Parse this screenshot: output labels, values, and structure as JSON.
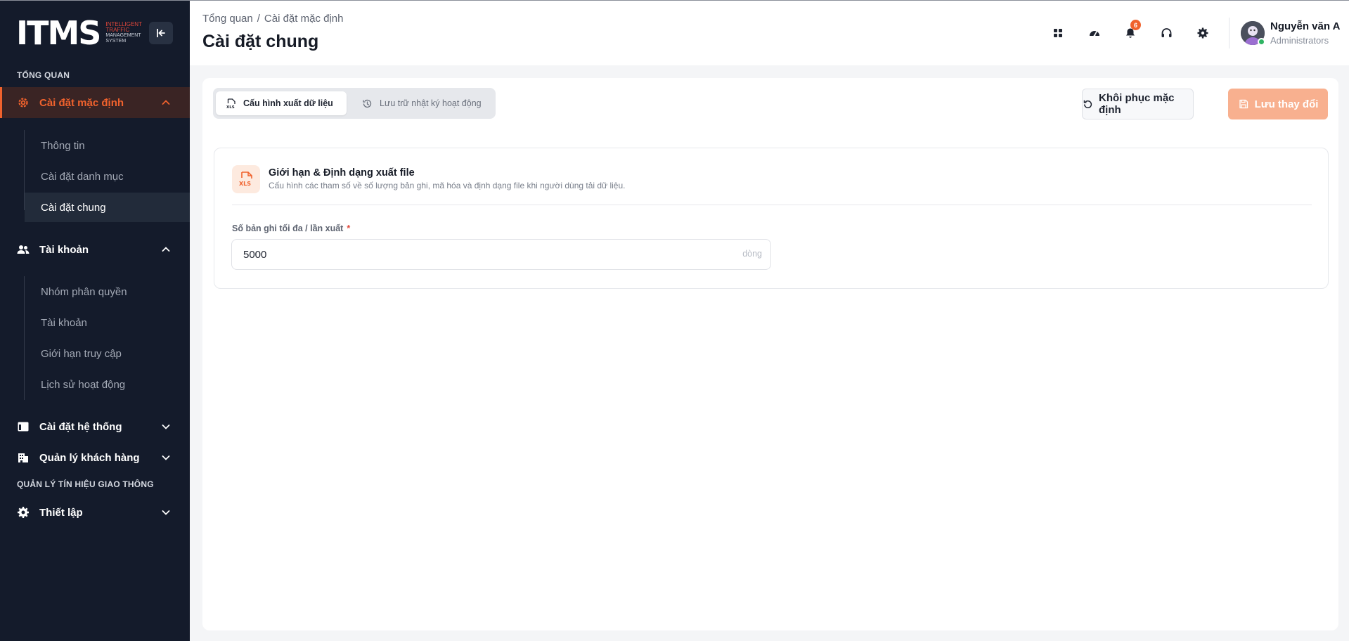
{
  "logo": {
    "text": "ITMS",
    "line1": "INTELLIGENT",
    "line2": "TRAFFIC",
    "line3": "MANAGEMENT",
    "line4": "SYSTEM"
  },
  "sidebar": {
    "section_overview": "TỔNG QUAN",
    "default_settings": {
      "label": "Cài đặt mặc định",
      "children": [
        "Thông tin",
        "Cài đặt danh mục",
        "Cài đặt chung"
      ]
    },
    "accounts": {
      "label": "Tài khoản",
      "children": [
        "Nhóm phân quyền",
        "Tài khoản",
        "Giới hạn truy cập",
        "Lịch sử hoạt động"
      ]
    },
    "system_settings": "Cài đặt hệ thống",
    "customers": "Quản lý khách hàng",
    "section_signals": "QUẢN LÝ TÍN HIỆU GIAO THÔNG",
    "setup": "Thiết lập"
  },
  "header": {
    "breadcrumb_root": "Tổng quan",
    "breadcrumb_sep": "/",
    "breadcrumb_current": "Cài đặt mặc định",
    "title": "Cài đặt chung",
    "notification_count": "6",
    "user_name": "Nguyễn văn A",
    "user_role": "Administrators"
  },
  "tabs": {
    "export": "Cấu hình xuất dữ liệu",
    "logs": "Lưu trữ nhật ký hoạt động"
  },
  "actions": {
    "reset": "Khôi phục mặc định",
    "save": "Lưu thay đổi"
  },
  "card": {
    "title": "Giới hạn & Định dạng xuất file",
    "description": "Cấu hình các tham số về số lượng bản ghi, mã hóa và định dạng file khi người dùng tải dữ liệu.",
    "icon_label": "XLS",
    "field_label": "Số bản ghi tối đa / lần xuất",
    "field_required": "*",
    "field_value": "5000",
    "field_suffix": "dòng"
  },
  "colors": {
    "accent": "#f0622d",
    "sidebar_bg": "#141b2b",
    "save_disabled": "#f8b08f"
  }
}
